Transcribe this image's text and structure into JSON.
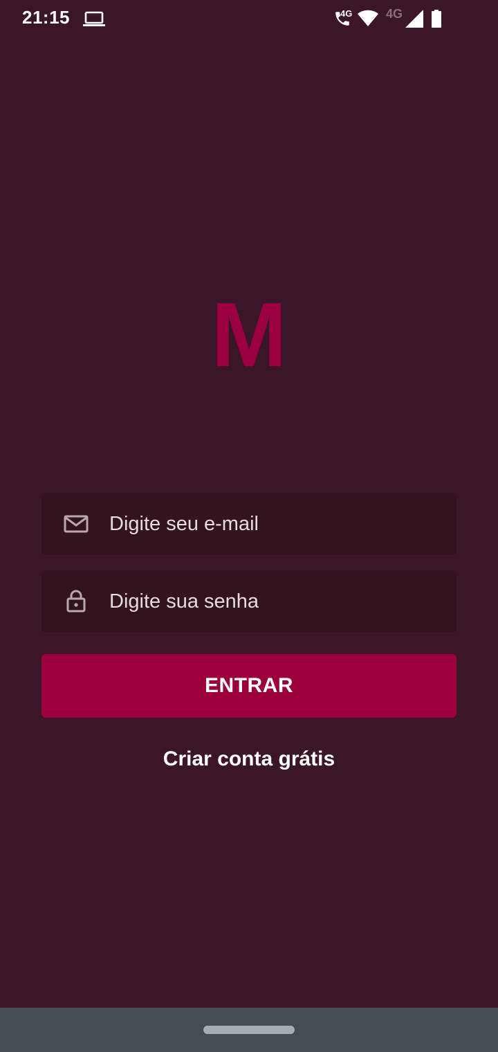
{
  "status_bar": {
    "time": "21:15",
    "lte_label_1": "4G",
    "lte_label_2": "4G",
    "icons": [
      "laptop-icon",
      "call-icon",
      "wifi-icon",
      "signal-icon",
      "battery-icon"
    ]
  },
  "logo": {
    "letter": "M",
    "color": "#9B0040"
  },
  "login_form": {
    "email": {
      "placeholder": "Digite seu e-mail",
      "value": "",
      "icon": "mail-icon"
    },
    "password": {
      "placeholder": "Digite sua senha",
      "value": "",
      "icon": "lock-icon"
    },
    "submit_label": "ENTRAR",
    "create_account_label": "Criar conta grátis"
  },
  "colors": {
    "background": "#3A1628",
    "field_background": "#331222",
    "accent": "#9B003C",
    "nav_bar": "#454D52"
  }
}
